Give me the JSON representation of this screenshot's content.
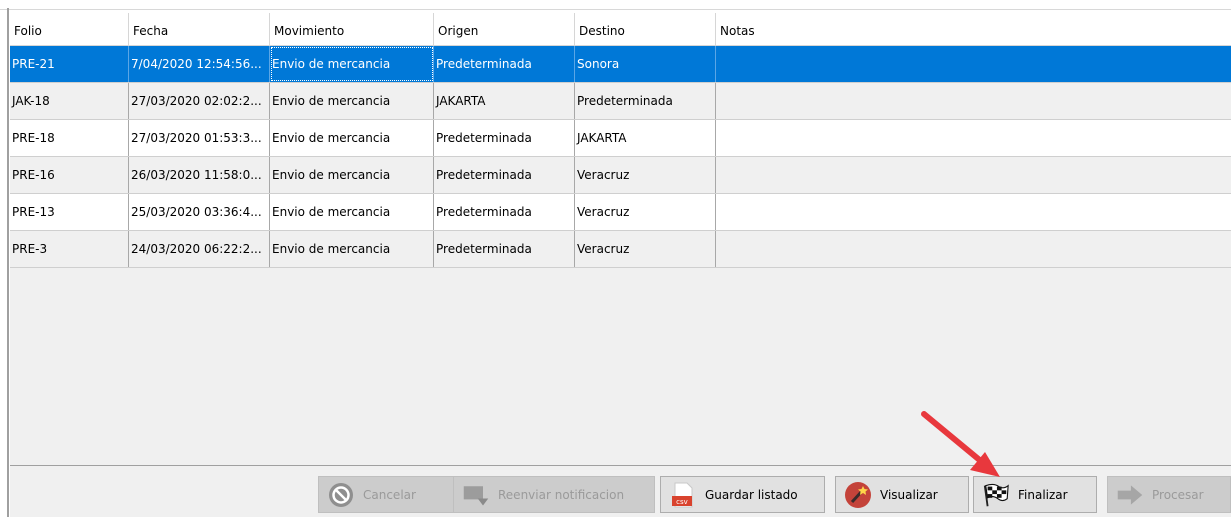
{
  "columns": [
    "Folio",
    "Fecha",
    "Movimiento",
    "Origen",
    "Destino",
    "Notas"
  ],
  "rows": [
    {
      "folio": "PRE-21",
      "fecha": "7/04/2020 12:54:56...",
      "movimiento": "Envio de mercancia",
      "origen": "Predeterminada",
      "destino": "Sonora",
      "notas": ""
    },
    {
      "folio": "JAK-18",
      "fecha": "27/03/2020 02:02:2...",
      "movimiento": "Envio de mercancia",
      "origen": "JAKARTA",
      "destino": "Predeterminada",
      "notas": ""
    },
    {
      "folio": "PRE-18",
      "fecha": "27/03/2020 01:53:3...",
      "movimiento": "Envio de mercancia",
      "origen": "Predeterminada",
      "destino": "JAKARTA",
      "notas": ""
    },
    {
      "folio": "PRE-16",
      "fecha": "26/03/2020 11:58:0...",
      "movimiento": "Envio de mercancia",
      "origen": "Predeterminada",
      "destino": "Veracruz",
      "notas": ""
    },
    {
      "folio": "PRE-13",
      "fecha": "25/03/2020 03:36:4...",
      "movimiento": "Envio de mercancia",
      "origen": "Predeterminada",
      "destino": "Veracruz",
      "notas": ""
    },
    {
      "folio": "PRE-3",
      "fecha": "24/03/2020 06:22:2...",
      "movimiento": "Envio de mercancia",
      "origen": "Predeterminada",
      "destino": "Veracruz",
      "notas": ""
    }
  ],
  "selected_row": 0,
  "toolbar": {
    "cancelar": {
      "label": "Cancelar",
      "icon": "cancel-icon",
      "enabled": false
    },
    "reenviar": {
      "label": "Reenviar notificacion",
      "icon": "resend-icon",
      "enabled": false
    },
    "guardar": {
      "label": "Guardar listado",
      "icon": "csv-file-icon",
      "icon_text": "csv",
      "enabled": true
    },
    "visualizar": {
      "label": "Visualizar",
      "icon": "magic-wand-icon",
      "enabled": true
    },
    "finalizar": {
      "label": "Finalizar",
      "icon": "checkered-flag-icon",
      "enabled": true
    },
    "procesar": {
      "label": "Procesar",
      "icon": "arrow-right-icon",
      "enabled": false
    }
  },
  "colors": {
    "selection": "#0078d7",
    "annotation_arrow": "#e8383d"
  }
}
